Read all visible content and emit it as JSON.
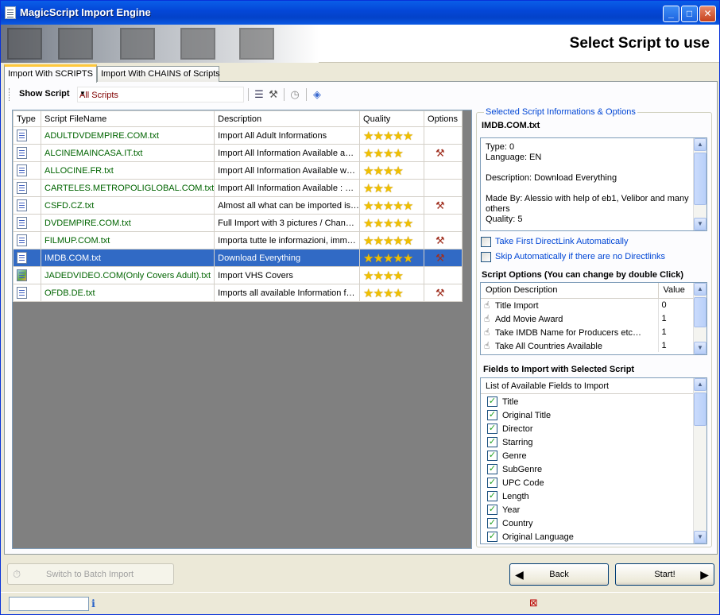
{
  "window": {
    "title": "MagicScript Import Engine",
    "controls": {
      "minimize": "_",
      "maximize": "□",
      "close": "✕"
    }
  },
  "header": {
    "title": "Select Script to use"
  },
  "tabs": [
    {
      "label": "Import With SCRIPTS",
      "active": true
    },
    {
      "label": "Import With CHAINS of Scripts",
      "active": false
    }
  ],
  "toolbar": {
    "show_label": "Show Script",
    "filter_value": "All Scripts",
    "icons": [
      "list-view-icon",
      "tools-icon",
      "clock-icon",
      "web-update-icon"
    ]
  },
  "grid": {
    "columns": [
      "Type",
      "Script FileName",
      "Description",
      "Quality",
      "Options"
    ],
    "rows": [
      {
        "type": "script",
        "file": "ADULTDVDEMPIRE.COM.txt",
        "desc": "Import All Adult Informations",
        "stars": "★★★★★",
        "options": false,
        "selected": false
      },
      {
        "type": "script",
        "file": "ALCINEMAINCASA.IT.txt",
        "desc": "Import All Information Available a…",
        "stars": "★★★★",
        "options": true,
        "selected": false
      },
      {
        "type": "script",
        "file": "ALLOCINE.FR.txt",
        "desc": "Import All Information Available w…",
        "stars": "★★★★",
        "options": false,
        "selected": false
      },
      {
        "type": "script",
        "file": "CARTELES.METROPOLIGLOBAL.COM.txt",
        "desc": "Import All Information Available : …",
        "stars": "★★★",
        "options": false,
        "selected": false
      },
      {
        "type": "script",
        "file": "CSFD.CZ.txt",
        "desc": "Almost all what can be imported is…",
        "stars": "★★★★★",
        "options": true,
        "selected": false
      },
      {
        "type": "script",
        "file": "DVDEMPIRE.COM.txt",
        "desc": "Full Import with 3 pictures / Chan…",
        "stars": "★★★★★",
        "options": false,
        "selected": false
      },
      {
        "type": "script",
        "file": "FILMUP.COM.txt",
        "desc": "Importa tutte le informazioni, imm…",
        "stars": "★★★★★",
        "options": true,
        "selected": false
      },
      {
        "type": "script",
        "file": "IMDB.COM.txt",
        "desc": "Download Everything",
        "stars": "★★★★★",
        "options": true,
        "selected": true
      },
      {
        "type": "image",
        "file": "JADEDVIDEO.COM(Only Covers Adult).txt",
        "desc": "Import VHS Covers",
        "stars": "★★★★",
        "options": false,
        "selected": false
      },
      {
        "type": "script",
        "file": "OFDB.DE.txt",
        "desc": "Imports all available Information f…",
        "stars": "★★★★",
        "options": true,
        "selected": false
      }
    ]
  },
  "info": {
    "legend": "Selected Script Informations & Options",
    "script_name": "IMDB.COM.txt",
    "details": "Type: 0\nLanguage: EN\n\nDescription: Download Everything\n\nMade By: Alessio with help of eb1, Velibor and many others\nQuality: 5",
    "take_first_label": "Take First DirectLink Automatically",
    "skip_label": "Skip Automatically if there are no Directlinks"
  },
  "script_options": {
    "title": "Script Options (You can change by double Click)",
    "columns": [
      "Option Description",
      "Value"
    ],
    "rows": [
      {
        "desc": "Title Import",
        "value": "0"
      },
      {
        "desc": "Add Movie Award",
        "value": "1"
      },
      {
        "desc": "Take IMDB Name for Producers etc…",
        "value": "1"
      },
      {
        "desc": "Take All Countries Available",
        "value": "1"
      }
    ]
  },
  "fields": {
    "title": "Fields to Import with Selected Script",
    "header": "List of Available Fields to Import",
    "items": [
      "Title",
      "Original Title",
      "Director",
      "Starring",
      "Genre",
      "SubGenre",
      "UPC Code",
      "Length",
      "Year",
      "Country",
      "Original Language"
    ]
  },
  "footer": {
    "batch_label": "Switch to Batch Import",
    "back_label": "Back",
    "start_label": "Start!"
  },
  "colors": {
    "selection": "#316ac5",
    "filename_green": "#006400",
    "link_blue": "#0046d5"
  }
}
